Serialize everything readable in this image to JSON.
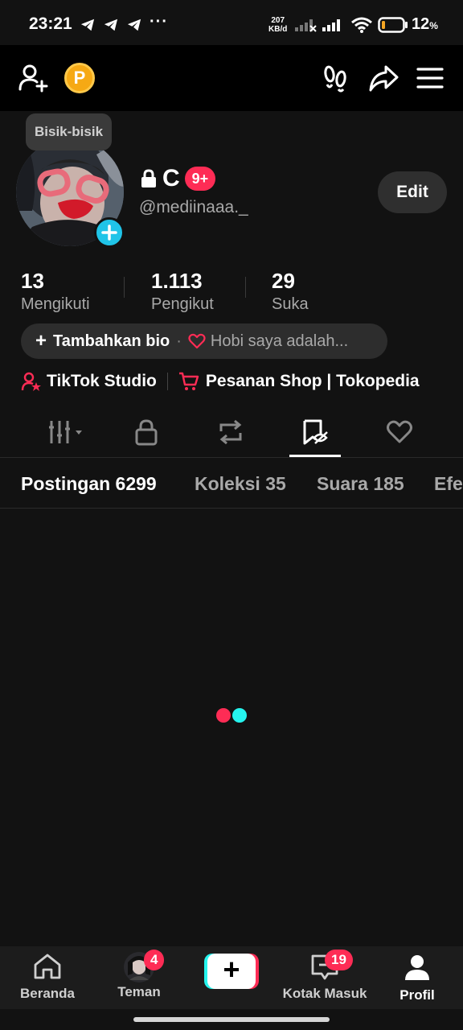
{
  "status_bar": {
    "time": "23:21",
    "dots": "···",
    "speed_value": "207",
    "speed_unit": "KB/d",
    "battery_pct": "12",
    "battery_unit": "%"
  },
  "topbar": {
    "coin_label": "P"
  },
  "profile": {
    "tooltip": "Bisik-bisik",
    "name": "C",
    "notif_badge": "9+",
    "handle": "@mediinaaa._",
    "edit_label": "Edit"
  },
  "stats": [
    {
      "value": "13",
      "label": "Mengikuti"
    },
    {
      "value": "1.113",
      "label": "Pengikut"
    },
    {
      "value": "29",
      "label": "Suka"
    }
  ],
  "bio": {
    "plus": "+",
    "add_label": "Tambahkan bio",
    "separator": "·",
    "hint": "Hobi saya adalah..."
  },
  "links": {
    "studio": "TikTok Studio",
    "shop": "Pesanan Shop | Tokopedia"
  },
  "text_tabs": [
    {
      "label": "Postingan 6299"
    },
    {
      "label": "Koleksi 35"
    },
    {
      "label": "Suara 185"
    },
    {
      "label": "Efe"
    }
  ],
  "bottom_nav": {
    "home": "Beranda",
    "friends": "Teman",
    "friends_badge": "4",
    "create": "+",
    "inbox": "Kotak Masuk",
    "inbox_badge": "19",
    "profile": "Profil"
  },
  "colors": {
    "accent": "#fe2c55",
    "cyan": "#25f4ee",
    "add_badge": "#20c4e8",
    "coin": "#f6a914"
  }
}
